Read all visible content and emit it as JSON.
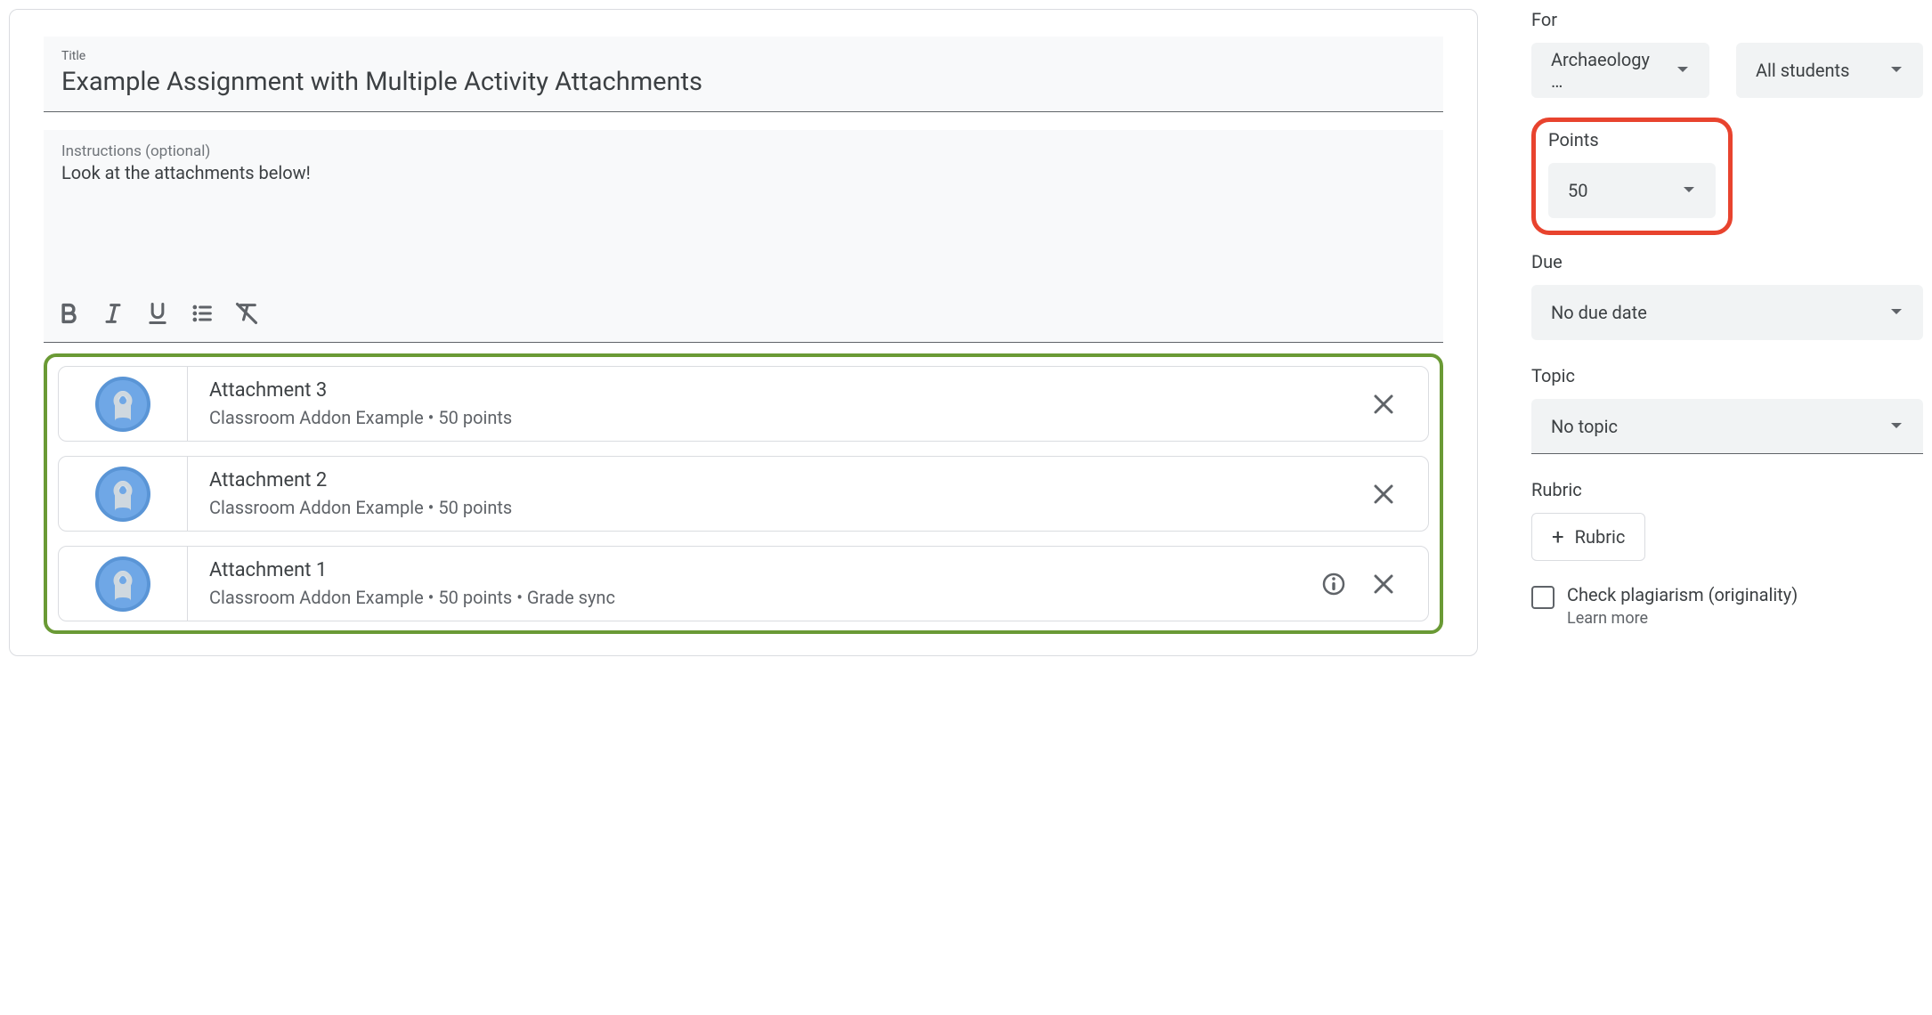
{
  "title_field": {
    "label": "Title",
    "value": "Example Assignment with Multiple Activity Attachments"
  },
  "instructions_field": {
    "label": "Instructions (optional)",
    "value": "Look at the attachments below!"
  },
  "attachments": [
    {
      "title": "Attachment 3",
      "sub": "Classroom Addon Example • 50 points",
      "info": false
    },
    {
      "title": "Attachment 2",
      "sub": "Classroom Addon Example • 50 points",
      "info": false
    },
    {
      "title": "Attachment 1",
      "sub": "Classroom Addon Example • 50 points • Grade sync",
      "info": true
    }
  ],
  "sidebar": {
    "for_label": "For",
    "class_chip": "Archaeology …",
    "students_chip": "All students",
    "points_label": "Points",
    "points_value": "50",
    "due_label": "Due",
    "due_chip": "No due date",
    "topic_label": "Topic",
    "topic_chip": "No topic",
    "rubric_label": "Rubric",
    "rubric_button": "Rubric",
    "plagiarism_label": "Check plagiarism (originality)",
    "learn_more": "Learn more"
  }
}
